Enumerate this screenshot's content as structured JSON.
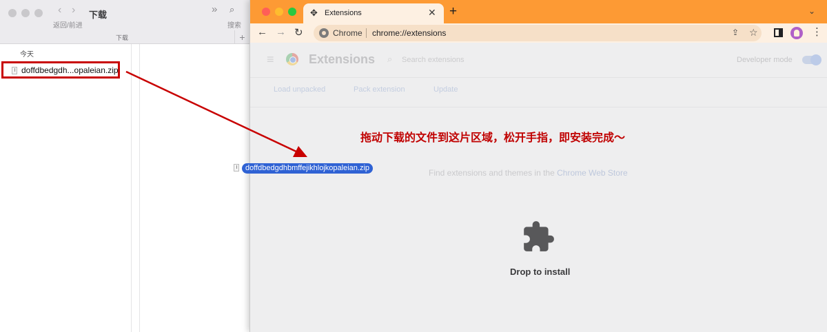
{
  "finder": {
    "title": "下载",
    "nav_label": "返回/前进",
    "search_label": "搜索",
    "tab_label": "下载",
    "group_label": "今天",
    "file_name": "doffdbedgdh...opaleian.zip",
    "icons": {
      "back": "chevron-left-icon",
      "forward": "chevron-right-icon",
      "more": "double-chevron-icon",
      "search": "magnifier-icon",
      "add": "plus-icon"
    }
  },
  "chrome": {
    "tab_title": "Extensions",
    "omnibox_scheme": "Chrome",
    "omnibox_url": "chrome://extensions",
    "page_title": "Extensions",
    "search_placeholder": "Search extensions",
    "developer_mode_label": "Developer mode",
    "developer_mode_on": true,
    "actions": {
      "load_unpacked": "Load unpacked",
      "pack_extension": "Pack extension",
      "update": "Update"
    },
    "store_prefix": "Find extensions and themes in the ",
    "store_link": "Chrome Web Store",
    "drop_label": "Drop to install",
    "colors": {
      "tabstrip": "#fd9a34",
      "toolbar": "#fdf0e2",
      "annotation_red": "#c00000",
      "drag_blue": "#2f62d4"
    }
  },
  "annotation": {
    "instruction": "拖动下载的文件到这片区域，松开手指，即安装完成～"
  },
  "drag_ghost": {
    "file_name": "doffdbedgdhbmffejikhlojkopaleian.zip"
  }
}
